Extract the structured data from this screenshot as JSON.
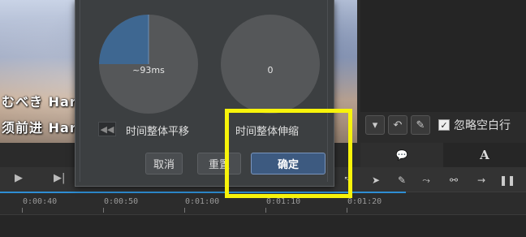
{
  "video": {
    "subtitle_line1": "むべき Har",
    "subtitle_line2": "须前进 Har"
  },
  "dialog": {
    "dial_left_value": "~93ms",
    "dial_right_value": "0",
    "dial_left_fill_fraction": 0.25,
    "label_shift": "时间整体平移",
    "label_stretch": "时间整体伸缩",
    "cancel_label": "取消",
    "reset_label": "重置",
    "ok_label": "确定"
  },
  "right_toolbar": {
    "ignore_blank_label": "忽略空白行",
    "ignore_blank_checked": true
  },
  "tabs": {
    "comment_tab": "💬",
    "style_tab": "A"
  },
  "timeline": {
    "ticks": [
      "0:00:40",
      "0:00:50",
      "0:01:00",
      "0:01:10",
      "0:01:20"
    ]
  },
  "colors": {
    "highlight": "#f7f30a",
    "accent_blue": "#2e8ed4",
    "ok_button": "#3d5a80",
    "dial_fill": "#3e6791"
  },
  "icons": {
    "play": "play-icon",
    "next_frame": "next-frame-icon",
    "prev": "skip-back-icon",
    "undo": "undo-icon",
    "pencil": "pencil-icon",
    "dropdown": "dropdown-icon"
  }
}
